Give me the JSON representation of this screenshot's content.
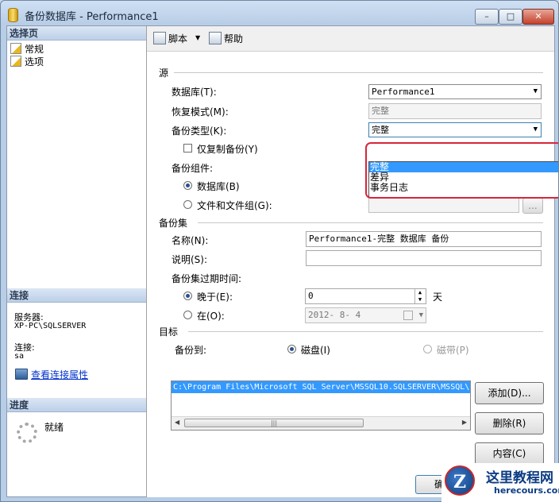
{
  "window": {
    "title": "备份数据库 - Performance1",
    "min": "–",
    "max": "□",
    "close": "✕"
  },
  "left": {
    "pages_header": "选择页",
    "pages": [
      "常规",
      "选项"
    ],
    "connection_header": "连接",
    "server_label": "服务器:",
    "server_value": "XP-PC\\SQLSERVER",
    "conn_label": "连接:",
    "conn_value": "sa",
    "view_props_link": "查看连接属性",
    "progress_header": "进度",
    "progress_status": "就绪"
  },
  "toolbar": {
    "script_label": "脚本",
    "script_arrow": "▼",
    "help_label": "帮助"
  },
  "source": {
    "group": "源",
    "database_label": "数据库(T):",
    "database_value": "Performance1",
    "recovery_label": "恢复模式(M):",
    "recovery_value": "完整",
    "backup_type_label": "备份类型(K):",
    "backup_type_value": "完整",
    "backup_type_options": [
      "完整",
      "差异",
      "事务日志"
    ],
    "copy_only_label": "仅复制备份(Y)",
    "component_label": "备份组件:",
    "component_db_label": "数据库(B)",
    "component_files_label": "文件和文件组(G):",
    "browse_label": "..."
  },
  "backupset": {
    "group": "备份集",
    "name_label": "名称(N):",
    "name_value": "Performance1-完整 数据库 备份",
    "desc_label": "说明(S):",
    "desc_value": "",
    "expire_label": "备份集过期时间:",
    "after_label": "晚于(E):",
    "after_value": "0",
    "after_unit": "天",
    "on_label": "在(O):",
    "on_value": "2012- 8- 4"
  },
  "destination": {
    "group": "目标",
    "backup_to_label": "备份到:",
    "disk_label": "磁盘(I)",
    "tape_label": "磁带(P)",
    "paths": [
      "C:\\Program Files\\Microsoft SQL Server\\MSSQL10.SQLSERVER\\MSSQL\\"
    ],
    "add_button": "添加(D)...",
    "remove_button": "删除(R)",
    "contents_button": "内容(C)"
  },
  "footer": {
    "ok_button": "确"
  },
  "watermark": {
    "logo_letter": "Z",
    "title": "这里教程网",
    "url": "herecours.com"
  }
}
